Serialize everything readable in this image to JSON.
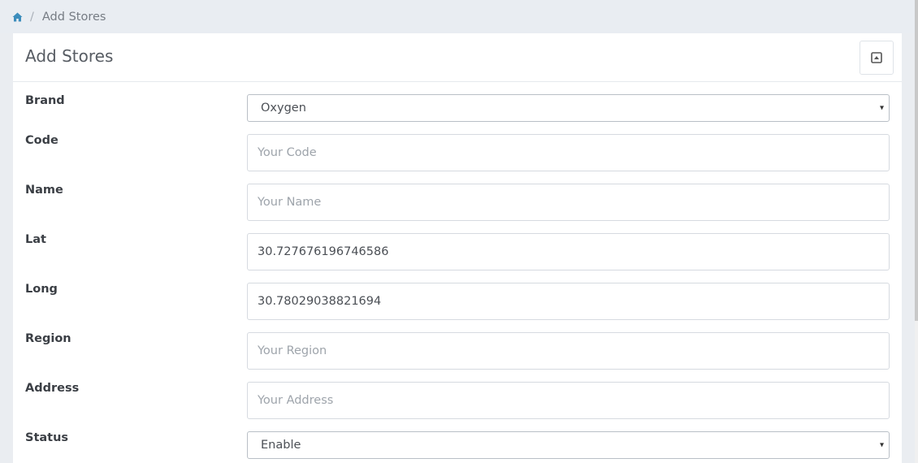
{
  "breadcrumb": {
    "home_icon": "home-icon",
    "separator": "/",
    "current": "Add Stores"
  },
  "panel": {
    "title": "Add Stores",
    "collapse_icon": "collapse-up-icon"
  },
  "form": {
    "brand": {
      "label": "Brand",
      "selected": "Oxygen"
    },
    "code": {
      "label": "Code",
      "value": "",
      "placeholder": "Your Code"
    },
    "name": {
      "label": "Name",
      "value": "",
      "placeholder": "Your Name"
    },
    "lat": {
      "label": "Lat",
      "value": "30.727676196746586",
      "placeholder": ""
    },
    "long": {
      "label": "Long",
      "value": "30.78029038821694",
      "placeholder": ""
    },
    "region": {
      "label": "Region",
      "value": "",
      "placeholder": "Your Region"
    },
    "address": {
      "label": "Address",
      "value": "",
      "placeholder": "Your Address"
    },
    "status": {
      "label": "Status",
      "selected": "Enable"
    },
    "select_arrow": "▾"
  },
  "colors": {
    "accent": "#3c8dbc",
    "page_bg": "#eaedf1",
    "panel_bg": "#ffffff"
  }
}
